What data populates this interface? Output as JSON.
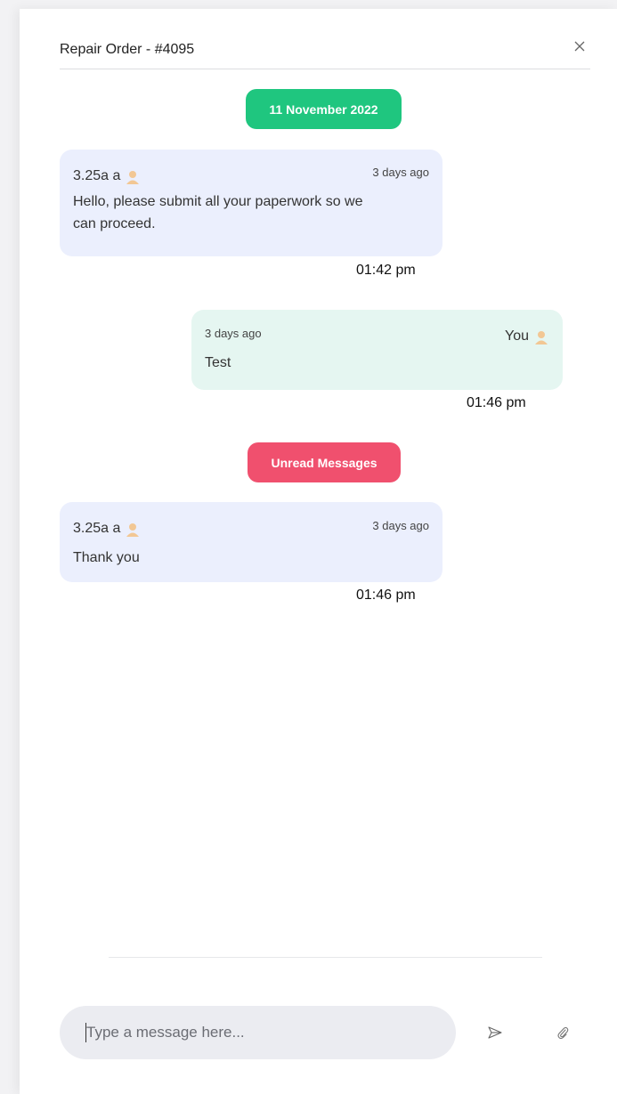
{
  "header": {
    "title": "Repair Order - #4095",
    "close_icon": "close-icon"
  },
  "separators": {
    "date": "11 November 2022",
    "unread": "Unread Messages"
  },
  "messages": [
    {
      "direction": "incoming",
      "sender": "3.25a a",
      "relative_time": "3 days ago",
      "text_line1": "Hello, please submit all your paperwork so we",
      "text_line2": "can proceed.",
      "time": "01:42 pm"
    },
    {
      "direction": "outgoing",
      "sender": "You",
      "relative_time": "3 days ago",
      "text": "Test",
      "time": "01:46 pm"
    },
    {
      "direction": "incoming",
      "sender": "3.25a a",
      "relative_time": "3 days ago",
      "text": "Thank you",
      "time": "01:46 pm"
    }
  ],
  "composer": {
    "placeholder": "Type a message here...",
    "value": "",
    "send_icon": "send-icon",
    "attach_icon": "paperclip-icon"
  },
  "colors": {
    "date_pill": "#1fc67f",
    "unread_pill": "#f0506e",
    "incoming_bubble": "#ebeffd",
    "outgoing_bubble": "#e5f6f1",
    "composer_bg": "#ebecf1"
  }
}
